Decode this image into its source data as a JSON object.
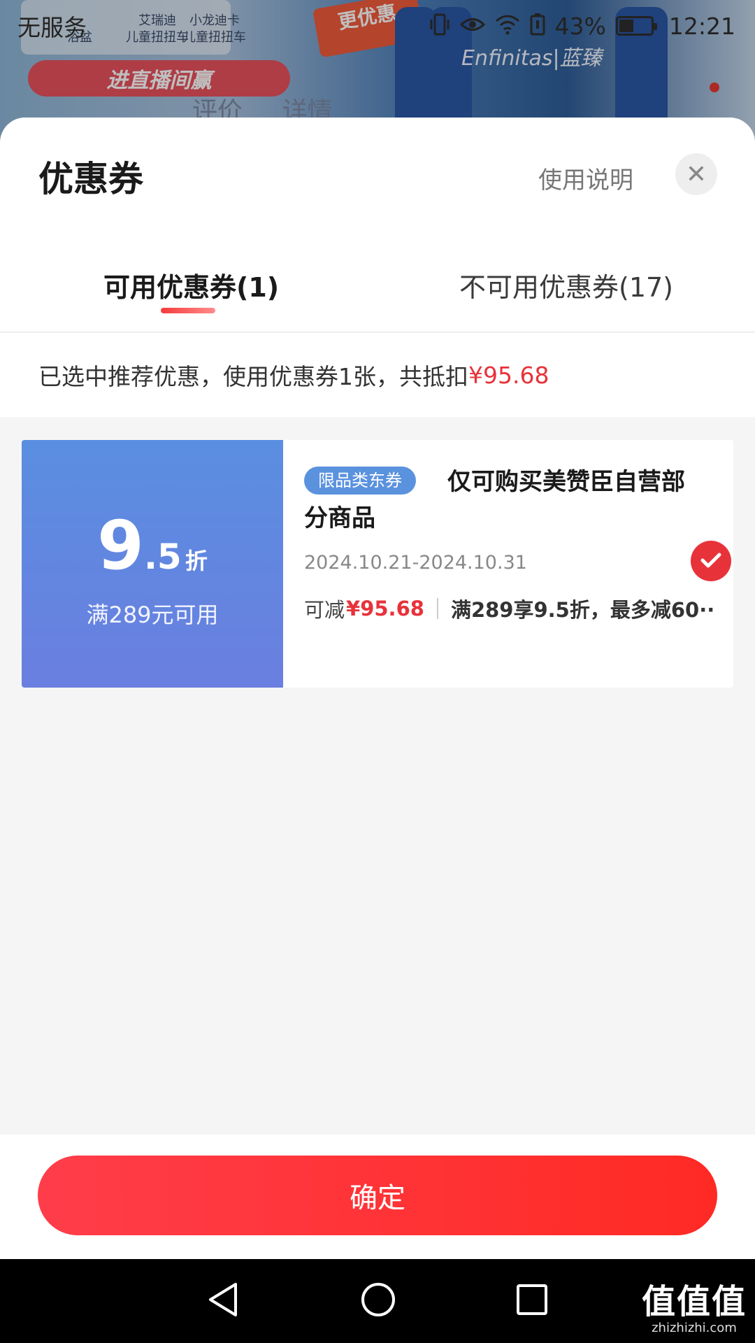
{
  "status_bar": {
    "carrier": "无服务",
    "battery": "43%",
    "time": "12:21",
    "icons": [
      "vibrate-icon",
      "eye-icon",
      "wifi-icon",
      "battery-saver-icon",
      "battery-icon"
    ]
  },
  "background_page": {
    "toy_labels": [
      "浴盆",
      "艾瑞迪\n儿童扭扭车",
      "小龙迪卡\n儿童扭扭车"
    ],
    "live_banner": "进直播间赢",
    "promo": "更优惠",
    "brand": "Enfinitas|蓝臻",
    "tabs": [
      "评价",
      "详情"
    ]
  },
  "sheet": {
    "title": "优惠券",
    "usage_link": "使用说明",
    "tabs": [
      {
        "label": "可用优惠券(1)",
        "active": true
      },
      {
        "label": "不可用优惠券(17)",
        "active": false
      }
    ],
    "summary_text": "已选中推荐优惠，使用优惠券1张，共抵扣",
    "summary_amount": "¥95.68"
  },
  "coupon": {
    "discount_int": "9",
    "discount_dec": ".5",
    "discount_unit": "折",
    "threshold": "满289元可用",
    "tag": "限品类东券",
    "title": "仅可购买美赞臣自营部分商品",
    "validity": "2024.10.21-2024.10.31",
    "deduct_label": "可减",
    "deduct_amount": "¥95.68",
    "rule": "满289享9.5折，最多减60··",
    "selected": true
  },
  "footer": {
    "confirm_label": "确定"
  },
  "watermark": {
    "logo": "值值值",
    "url": "zhizhizhi.com"
  },
  "colors": {
    "accent_red": "#e8323a",
    "coupon_blue": "#5a8ee0",
    "button_red": "#ff3d4a"
  }
}
